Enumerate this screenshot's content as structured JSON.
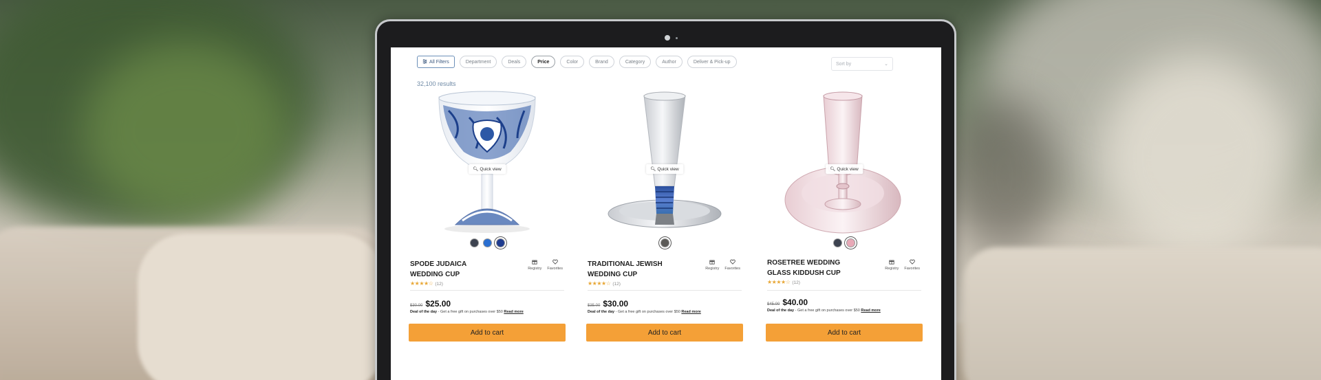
{
  "filters": {
    "all_filters": "All Filters",
    "chips": [
      "Department",
      "Deals",
      "Price",
      "Color",
      "Brand",
      "Category",
      "Author",
      "Deliver & Pick-up"
    ],
    "active": "Price",
    "sort_placeholder": "Sort by"
  },
  "results_text": "32,100 results",
  "quick_view_label": "Quick view",
  "registry_label": "Registry",
  "favorites_label": "Favorites",
  "deal_prefix": "Deal of the day",
  "deal_text": " - Get a free gift on purchases over $50 ",
  "read_more": "Read more",
  "add_to_cart": "Add to cart",
  "products": [
    {
      "name_line1": "SPODE JUDAICA",
      "name_line2": "WEDDING CUP",
      "rating_stars": "★★★★☆",
      "review_count": "(12)",
      "old_price": "$30.00",
      "price": "$25.00",
      "swatches": [
        "#3d4350",
        "#2a6fd1",
        "#1f3c8f"
      ],
      "selected_swatch": 2
    },
    {
      "name_line1": "TRADITIONAL JEWISH",
      "name_line2": "WEDDING CUP",
      "rating_stars": "★★★★☆",
      "review_count": "(12)",
      "old_price": "$35.00",
      "price": "$30.00",
      "swatches": [
        "#5b5a57"
      ],
      "selected_swatch": 0
    },
    {
      "name_line1": "ROSETREE WEDDING",
      "name_line2": "GLASS KIDDUSH CUP",
      "rating_stars": "★★★★☆",
      "review_count": "(12)",
      "old_price": "$45.00",
      "price": "$40.00",
      "swatches": [
        "#3d4350",
        "#e8a9b7"
      ],
      "selected_swatch": 1
    }
  ],
  "colors": {
    "cart_button": "#f4a037",
    "star": "#e8a735",
    "results": "#6f8aa6"
  }
}
